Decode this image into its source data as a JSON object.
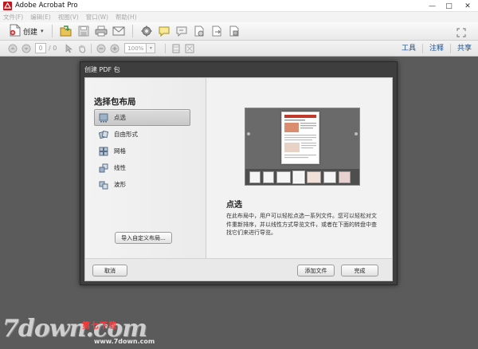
{
  "window": {
    "title": "Adobe Acrobat Pro",
    "controls": {
      "minimize": "—",
      "maximize": "□",
      "close": "✕"
    }
  },
  "menu": {
    "items": [
      "文件(F)",
      "编辑(E)",
      "视图(V)",
      "窗口(W)",
      "帮助(H)"
    ]
  },
  "toolbar": {
    "create_label": "创建",
    "icons": [
      "open-folder-icon",
      "save-icon",
      "print-icon",
      "email-icon",
      "settings-gear-icon",
      "comment-icon",
      "sign-icon",
      "stamp-icon",
      "export-icon",
      "share-icon",
      "expand-icon"
    ]
  },
  "nav": {
    "current_page": "0",
    "page_total": "/ 0",
    "zoom": "100%",
    "links": {
      "tools": "工具",
      "comment": "注释",
      "share": "共享"
    }
  },
  "dialog": {
    "title": "创建 PDF 包",
    "layout_heading": "选择包布局",
    "layouts": [
      {
        "label": "点选",
        "icon": "click-through-icon"
      },
      {
        "label": "自由形式",
        "icon": "freeform-icon"
      },
      {
        "label": "网格",
        "icon": "grid-icon"
      },
      {
        "label": "线性",
        "icon": "linear-icon"
      },
      {
        "label": "波形",
        "icon": "wave-icon"
      }
    ],
    "selected_layout": "点选",
    "import_button": "导入自定义布局...",
    "detail_title": "点选",
    "detail_desc": "在此布局中，用户可以轻松点选一系列文件。您可以轻松对文件重新排序，并以线性方式导览文件，或者在下面的转盘中查找它们来进行导览。",
    "buttons": {
      "cancel": "取消",
      "add_files": "添加文件",
      "finish": "完成"
    }
  },
  "watermark": {
    "logo": "7down.com",
    "cn": "第七下载",
    "url": "www.7down.com"
  },
  "colors": {
    "workspace": "#5b5b5b",
    "dialog_frame": "#3e3e3e",
    "link": "#1a4f8c"
  }
}
